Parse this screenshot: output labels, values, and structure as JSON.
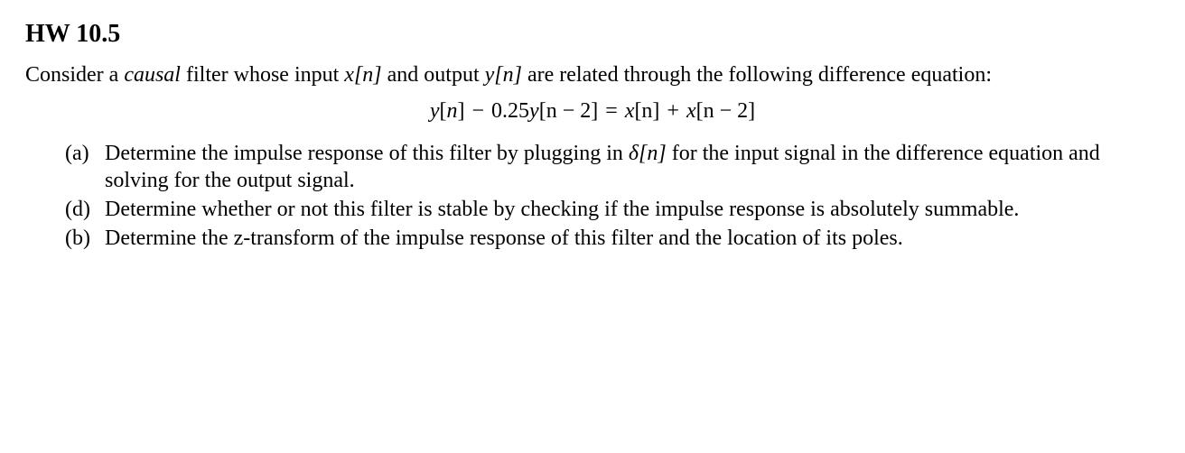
{
  "title": "HW 10.5",
  "intro": {
    "pre": "Consider a ",
    "emph": "causal",
    "post": " filter whose input ",
    "xn": "x[n]",
    "mid": " and output ",
    "yn": "y[n]",
    "tail": " are related through the following difference equation:"
  },
  "equation": {
    "lhs_y": "y",
    "lhs_n_open": "[",
    "lhs_n": "n",
    "lhs_n_close": "]",
    "minus": " − ",
    "coef": "0.25",
    "y2": "y",
    "y2_arg": "[n − 2]",
    "eq": " = ",
    "rhs_x1": "x",
    "rhs_x1_arg": "[n]",
    "plus": " + ",
    "rhs_x2": "x",
    "rhs_x2_arg": "[n − 2]"
  },
  "items": [
    {
      "marker": "(a)",
      "text_pre": "Determine the impulse response of this filter by plugging in ",
      "delta": "δ[n]",
      "text_post": " for the input signal in the difference equation and solving for the output signal."
    },
    {
      "marker": "(d)",
      "text_pre": "Determine whether or not this filter is stable by checking if the impulse response is absolutely summable.",
      "delta": "",
      "text_post": ""
    },
    {
      "marker": "(b)",
      "text_pre": "Determine the z-transform of the impulse response of this filter and the location of its poles.",
      "delta": "",
      "text_post": ""
    }
  ]
}
